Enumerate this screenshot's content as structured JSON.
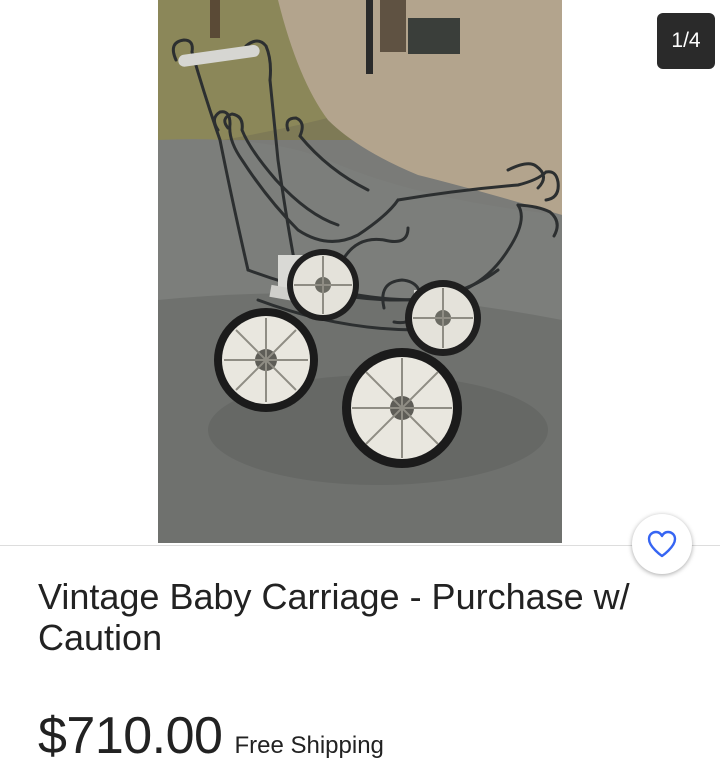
{
  "gallery": {
    "image_subject": "Vintage baby carriage photo",
    "counter": "1/4"
  },
  "listing": {
    "title": "Vintage Baby Carriage - Purchase w/ Caution",
    "price": "$710.00",
    "shipping": "Free Shipping"
  },
  "icons": {
    "watch": "heart-outline-icon"
  },
  "colors": {
    "accent": "#3665f3",
    "counter_bg": "#2a2a2a"
  }
}
